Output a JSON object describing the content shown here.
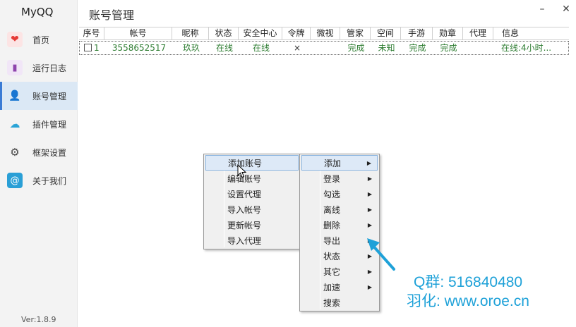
{
  "app": {
    "title": "MyQQ",
    "version": "Ver:1.8.9"
  },
  "header": {
    "title": "账号管理",
    "minimize": "–",
    "close": "✕"
  },
  "sidebar": {
    "items": [
      {
        "label": "首页",
        "icon": "heart-icon",
        "color": "#e53935"
      },
      {
        "label": "运行日志",
        "icon": "bookmark-icon",
        "color": "#8e44ad"
      },
      {
        "label": "账号管理",
        "icon": "user-icon",
        "color": "#333333",
        "active": true
      },
      {
        "label": "插件管理",
        "icon": "cloud-icon",
        "color": "#29a3d6"
      },
      {
        "label": "框架设置",
        "icon": "gear-icon",
        "color": "#444444"
      },
      {
        "label": "关于我们",
        "icon": "at-icon",
        "color": "#2a9fd6"
      }
    ]
  },
  "table": {
    "columns": [
      "序号",
      "帐号",
      "昵称",
      "状态",
      "安全中心",
      "令牌",
      "微视",
      "管家",
      "空间",
      "手游",
      "勋章",
      "代理",
      "信息"
    ],
    "rows": [
      [
        "1",
        "3558652517",
        "玖玖",
        "在线",
        "在线",
        "×",
        "",
        "完成",
        "未知",
        "完成",
        "完成",
        "",
        "在线:4小时..."
      ]
    ]
  },
  "context_menu": {
    "items": [
      "添加账号",
      "编辑账号",
      "设置代理",
      "导入帐号",
      "更新帐号",
      "导入代理"
    ],
    "highlighted": 0
  },
  "sub_menu": {
    "items": [
      "添加",
      "登录",
      "勾选",
      "离线",
      "删除",
      "导出",
      "状态",
      "其它",
      "加速",
      "搜索"
    ],
    "has_arrow": [
      true,
      true,
      true,
      true,
      true,
      true,
      true,
      true,
      true,
      false
    ],
    "highlighted": 0
  },
  "watermark": {
    "line1": "Q群: 516840480",
    "line2": "羽化: www.oroe.cn",
    "color": "#1ea1d8"
  }
}
